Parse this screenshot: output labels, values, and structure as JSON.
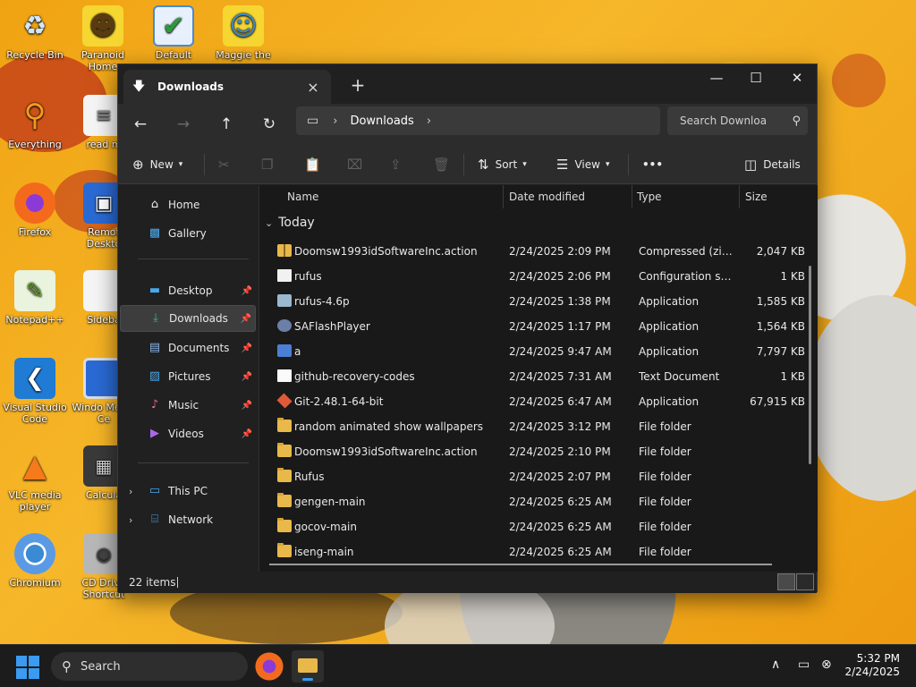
{
  "desktop": {
    "icons": [
      {
        "label": "Recycle Bin",
        "icon": "recycle-bin-icon"
      },
      {
        "label": "Paranoid Home",
        "icon": "cartoon-character-icon"
      },
      {
        "label": "Default",
        "icon": "default-shortcut-icon"
      },
      {
        "label": "Maggie the",
        "icon": "cartoon-character-icon"
      },
      {
        "label": "Everything",
        "icon": "search-magnifier-icon"
      },
      {
        "label": "read m",
        "icon": "text-document-icon"
      },
      {
        "label": "Firefox",
        "icon": "firefox-icon"
      },
      {
        "label": "Remot Deskto",
        "icon": "remote-desktop-icon"
      },
      {
        "label": "Notepad++",
        "icon": "notepad-plus-plus-icon"
      },
      {
        "label": "Sideba",
        "icon": "document-icon"
      },
      {
        "label": "Visual Studio Code",
        "icon": "vscode-icon"
      },
      {
        "label": "Windo Media Ce",
        "icon": "media-center-icon"
      },
      {
        "label": "VLC media player",
        "icon": "vlc-icon"
      },
      {
        "label": "Calcula",
        "icon": "calculator-icon"
      },
      {
        "label": "Chromium",
        "icon": "chromium-icon"
      },
      {
        "label": "CD Drive Shortcut",
        "icon": "cd-drive-icon"
      }
    ]
  },
  "window": {
    "tab_title": "Downloads",
    "address": {
      "root_icon": "this-pc-icon",
      "crumb": "Downloads"
    },
    "search_placeholder": "Search Downloa",
    "toolbar": {
      "new_label": "New",
      "sort_label": "Sort",
      "view_label": "View",
      "more_label": "•••",
      "details_label": "Details"
    },
    "nav": {
      "home": "Home",
      "gallery": "Gallery",
      "desktop": "Desktop",
      "downloads": "Downloads",
      "documents": "Documents",
      "pictures": "Pictures",
      "music": "Music",
      "videos": "Videos",
      "this_pc": "This PC",
      "network": "Network"
    },
    "columns": {
      "name": "Name",
      "date": "Date modified",
      "type": "Type",
      "size": "Size"
    },
    "group_label": "Today",
    "files": [
      {
        "name": "Doomsw1993idSoftwareInc.action",
        "date": "2/24/2025 2:09 PM",
        "type": "Compressed (zipp...",
        "size": "2,047 KB",
        "kind": "zip"
      },
      {
        "name": "rufus",
        "date": "2/24/2025 2:06 PM",
        "type": "Configuration sett...",
        "size": "1 KB",
        "kind": "cfg"
      },
      {
        "name": "rufus-4.6p",
        "date": "2/24/2025 1:38 PM",
        "type": "Application",
        "size": "1,585 KB",
        "kind": "rufus"
      },
      {
        "name": "SAFlashPlayer",
        "date": "2/24/2025 1:17 PM",
        "type": "Application",
        "size": "1,564 KB",
        "kind": "flash"
      },
      {
        "name": "a",
        "date": "2/24/2025 9:47 AM",
        "type": "Application",
        "size": "7,797 KB",
        "kind": "app"
      },
      {
        "name": "github-recovery-codes",
        "date": "2/24/2025 7:31 AM",
        "type": "Text Document",
        "size": "1 KB",
        "kind": "txt"
      },
      {
        "name": "Git-2.48.1-64-bit",
        "date": "2/24/2025 6:47 AM",
        "type": "Application",
        "size": "67,915 KB",
        "kind": "git"
      },
      {
        "name": "random animated show wallpapers",
        "date": "2/24/2025 3:12 PM",
        "type": "File folder",
        "size": "",
        "kind": "folder"
      },
      {
        "name": "Doomsw1993idSoftwareInc.action",
        "date": "2/24/2025 2:10 PM",
        "type": "File folder",
        "size": "",
        "kind": "folder"
      },
      {
        "name": "Rufus",
        "date": "2/24/2025 2:07 PM",
        "type": "File folder",
        "size": "",
        "kind": "folder"
      },
      {
        "name": "gengen-main",
        "date": "2/24/2025 6:25 AM",
        "type": "File folder",
        "size": "",
        "kind": "folder"
      },
      {
        "name": "gocov-main",
        "date": "2/24/2025 6:25 AM",
        "type": "File folder",
        "size": "",
        "kind": "folder"
      },
      {
        "name": "iseng-main",
        "date": "2/24/2025 6:25 AM",
        "type": "File folder",
        "size": "",
        "kind": "folder"
      }
    ],
    "status": {
      "item_count": "22 items"
    }
  },
  "taskbar": {
    "search_label": "Search",
    "time": "5:32 PM",
    "date": "2/24/2025"
  },
  "colors": {
    "accent": "#3a9bf0",
    "window_bg": "#202020",
    "list_bg": "#191919"
  }
}
